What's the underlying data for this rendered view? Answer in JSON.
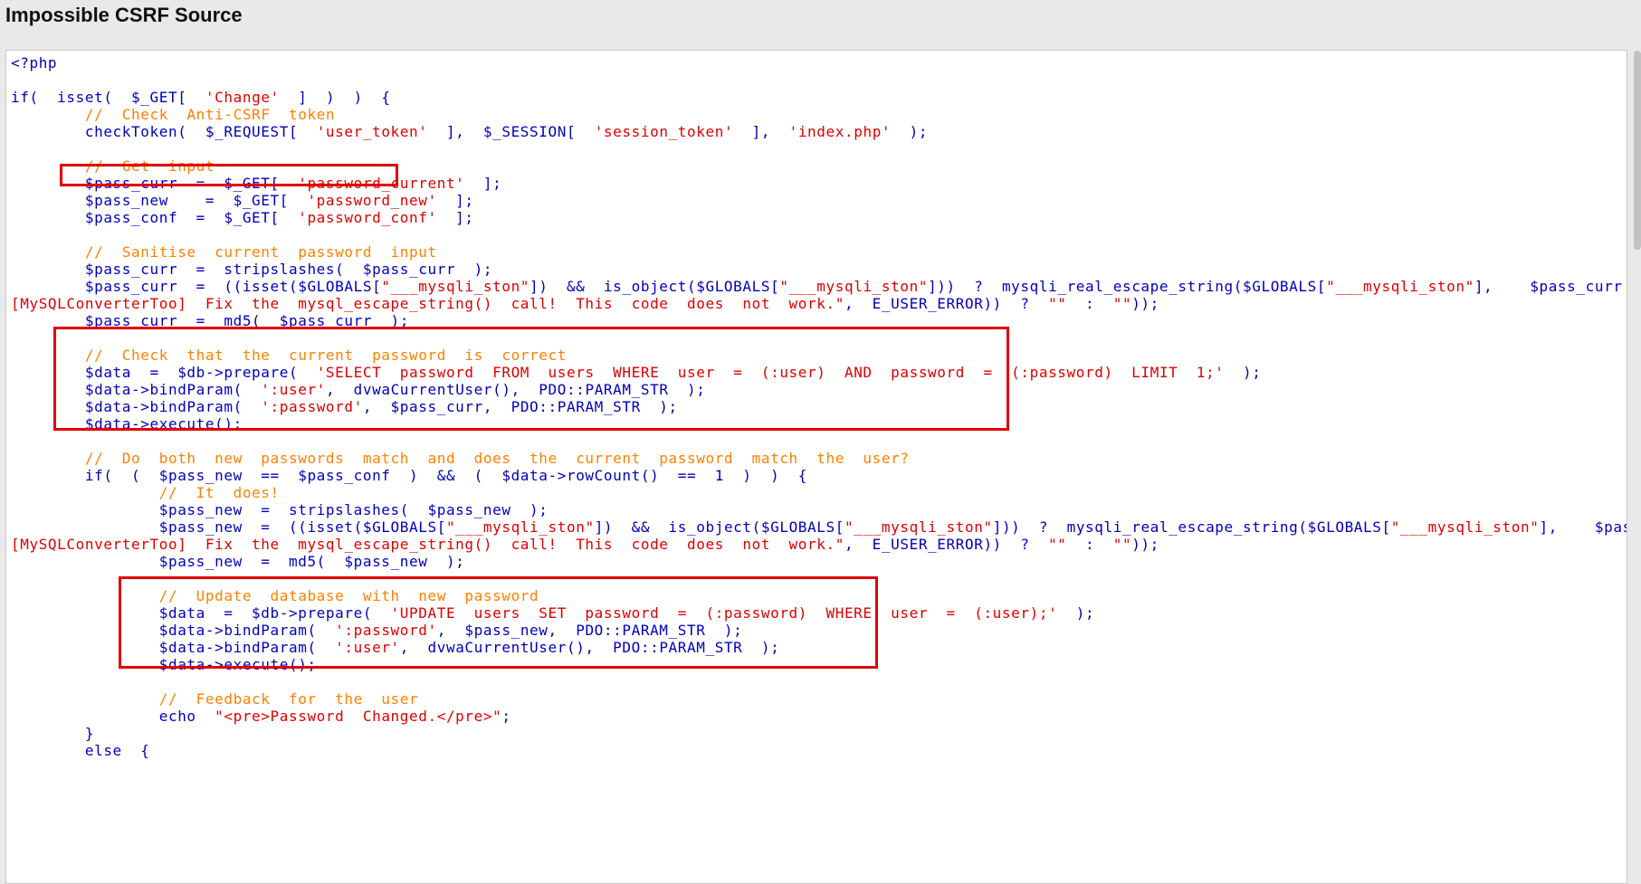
{
  "page": {
    "title": "Impossible CSRF Source"
  },
  "code_lines": [
    {
      "segments": [
        {
          "t": "v",
          "x": "&lt;?php"
        }
      ]
    },
    {
      "segments": []
    },
    {
      "segments": [
        {
          "t": "v",
          "x": "if("
        },
        {
          "t": "p",
          "x": "  "
        },
        {
          "t": "v",
          "x": "isset("
        },
        {
          "t": "p",
          "x": "  "
        },
        {
          "t": "v",
          "x": "$_GET["
        },
        {
          "t": "p",
          "x": "  "
        },
        {
          "t": "s",
          "x": "'Change'"
        },
        {
          "t": "p",
          "x": "  "
        },
        {
          "t": "v",
          "x": "]  )  )  {"
        }
      ]
    },
    {
      "segments": [
        {
          "t": "c",
          "x": "        //  Check  Anti-CSRF  token"
        }
      ]
    },
    {
      "segments": [
        {
          "t": "v",
          "x": "        checkToken(  $_REQUEST[  "
        },
        {
          "t": "s",
          "x": "'user_token'"
        },
        {
          "t": "v",
          "x": "  ],  $_SESSION[  "
        },
        {
          "t": "s",
          "x": "'session_token'"
        },
        {
          "t": "v",
          "x": "  ],  "
        },
        {
          "t": "s",
          "x": "'index.php'"
        },
        {
          "t": "v",
          "x": "  );"
        }
      ]
    },
    {
      "segments": []
    },
    {
      "segments": [
        {
          "t": "c",
          "x": "        //  Get  input"
        }
      ]
    },
    {
      "segments": [
        {
          "t": "v",
          "x": "        $pass_curr  =  $_GET[  "
        },
        {
          "t": "s",
          "x": "'password_current'"
        },
        {
          "t": "v",
          "x": "  ];"
        }
      ]
    },
    {
      "segments": [
        {
          "t": "v",
          "x": "        $pass_new    =  $_GET[  "
        },
        {
          "t": "s",
          "x": "'password_new'"
        },
        {
          "t": "v",
          "x": "  ];"
        }
      ]
    },
    {
      "segments": [
        {
          "t": "v",
          "x": "        $pass_conf  =  $_GET[  "
        },
        {
          "t": "s",
          "x": "'password_conf'"
        },
        {
          "t": "v",
          "x": "  ];"
        }
      ]
    },
    {
      "segments": []
    },
    {
      "segments": [
        {
          "t": "c",
          "x": "        //  Sanitise  current  password  input"
        }
      ]
    },
    {
      "segments": [
        {
          "t": "v",
          "x": "        $pass_curr  =  stripslashes(  $pass_curr  );"
        }
      ]
    },
    {
      "segments": [
        {
          "t": "v",
          "x": "        $pass_curr  =  ((isset($GLOBALS["
        },
        {
          "t": "s",
          "x": "\"___mysqli_ston\""
        },
        {
          "t": "v",
          "x": "])  &&  is_object($GLOBALS["
        },
        {
          "t": "s",
          "x": "\"___mysqli_ston\""
        },
        {
          "t": "v",
          "x": "]))  ?  mysqli_real_escape_string($GLOBALS["
        },
        {
          "t": "s",
          "x": "\"___mysqli_ston\""
        },
        {
          "t": "v",
          "x": "],    $pass_curr  )  :  ((trigger_error("
        }
      ]
    },
    {
      "segments": [
        {
          "t": "s",
          "x": "[MySQLConverterToo]  Fix  the  mysql_escape_string()  call!  This  code  does  not  work.\""
        },
        {
          "t": "v",
          "x": ",  E_USER_ERROR))  ?  "
        },
        {
          "t": "s",
          "x": "\"\""
        },
        {
          "t": "v",
          "x": "  :  "
        },
        {
          "t": "s",
          "x": "\"\""
        },
        {
          "t": "v",
          "x": "));"
        }
      ]
    },
    {
      "segments": [
        {
          "t": "v",
          "x": "        $pass_curr  =  md5(  $pass_curr  );"
        }
      ]
    },
    {
      "segments": []
    },
    {
      "segments": [
        {
          "t": "c",
          "x": "        //  Check  that  the  current  password  is  correct"
        }
      ]
    },
    {
      "segments": [
        {
          "t": "v",
          "x": "        $data  =  $db->prepare(  "
        },
        {
          "t": "s",
          "x": "'SELECT  password  FROM  users  WHERE  user  =  (:user)  AND  password  =  (:password)  LIMIT  1;'"
        },
        {
          "t": "v",
          "x": "  );"
        }
      ]
    },
    {
      "segments": [
        {
          "t": "v",
          "x": "        $data->bindParam(  "
        },
        {
          "t": "s",
          "x": "':user'"
        },
        {
          "t": "v",
          "x": ",  dvwaCurrentUser(),  PDO::PARAM_STR  );"
        }
      ]
    },
    {
      "segments": [
        {
          "t": "v",
          "x": "        $data->bindParam(  "
        },
        {
          "t": "s",
          "x": "':password'"
        },
        {
          "t": "v",
          "x": ",  $pass_curr,  PDO::PARAM_STR  );"
        }
      ]
    },
    {
      "segments": [
        {
          "t": "v",
          "x": "        $data->execute();"
        }
      ]
    },
    {
      "segments": []
    },
    {
      "segments": [
        {
          "t": "c",
          "x": "        //  Do  both  new  passwords  match  and  does  the  current  password  match  the  user?"
        }
      ]
    },
    {
      "segments": [
        {
          "t": "v",
          "x": "        if(  (  $pass_new  ==  $pass_conf  )  &&  (  $data->rowCount()  ==  1  )  )  {"
        }
      ]
    },
    {
      "segments": [
        {
          "t": "c",
          "x": "                //  It  does!"
        }
      ]
    },
    {
      "segments": [
        {
          "t": "v",
          "x": "                $pass_new  =  stripslashes(  $pass_new  );"
        }
      ]
    },
    {
      "segments": [
        {
          "t": "v",
          "x": "                $pass_new  =  ((isset($GLOBALS["
        },
        {
          "t": "s",
          "x": "\"___mysqli_ston\""
        },
        {
          "t": "v",
          "x": "])  &&  is_object($GLOBALS["
        },
        {
          "t": "s",
          "x": "\"___mysqli_ston\""
        },
        {
          "t": "v",
          "x": "]))  ?  mysqli_real_escape_string($GLOBALS["
        },
        {
          "t": "s",
          "x": "\"___mysqli_ston\""
        },
        {
          "t": "v",
          "x": "],    $pass_new  )  :  ((trigger_error("
        }
      ]
    },
    {
      "segments": [
        {
          "t": "s",
          "x": "[MySQLConverterToo]  Fix  the  mysql_escape_string()  call!  This  code  does  not  work.\""
        },
        {
          "t": "v",
          "x": ",  E_USER_ERROR))  ?  "
        },
        {
          "t": "s",
          "x": "\"\""
        },
        {
          "t": "v",
          "x": "  :  "
        },
        {
          "t": "s",
          "x": "\"\""
        },
        {
          "t": "v",
          "x": "));"
        }
      ]
    },
    {
      "segments": [
        {
          "t": "v",
          "x": "                $pass_new  =  md5(  $pass_new  );"
        }
      ]
    },
    {
      "segments": []
    },
    {
      "segments": [
        {
          "t": "c",
          "x": "                //  Update  database  with  new  password"
        }
      ]
    },
    {
      "segments": [
        {
          "t": "v",
          "x": "                $data  =  $db->prepare(  "
        },
        {
          "t": "s",
          "x": "'UPDATE  users  SET  password  =  (:password)  WHERE  user  =  (:user);'"
        },
        {
          "t": "v",
          "x": "  );"
        }
      ]
    },
    {
      "segments": [
        {
          "t": "v",
          "x": "                $data->bindParam(  "
        },
        {
          "t": "s",
          "x": "':password'"
        },
        {
          "t": "v",
          "x": ",  $pass_new,  PDO::PARAM_STR  );"
        }
      ]
    },
    {
      "segments": [
        {
          "t": "v",
          "x": "                $data->bindParam(  "
        },
        {
          "t": "s",
          "x": "':user'"
        },
        {
          "t": "v",
          "x": ",  dvwaCurrentUser(),  PDO::PARAM_STR  );"
        }
      ]
    },
    {
      "segments": [
        {
          "t": "v",
          "x": "                $data->execute();"
        }
      ]
    },
    {
      "segments": []
    },
    {
      "segments": [
        {
          "t": "c",
          "x": "                //  Feedback  for  the  user"
        }
      ]
    },
    {
      "segments": [
        {
          "t": "v",
          "x": "                echo  "
        },
        {
          "t": "s",
          "x": "\"&lt;pre&gt;Password  Changed.&lt;/pre&gt;\""
        },
        {
          "t": "v",
          "x": ";"
        }
      ]
    },
    {
      "segments": [
        {
          "t": "v",
          "x": "        }"
        }
      ]
    },
    {
      "segments": [
        {
          "t": "v",
          "x": "        else  {"
        }
      ]
    }
  ],
  "highlights": [
    {
      "name": "highlight-get-input"
    },
    {
      "name": "highlight-check-password"
    },
    {
      "name": "highlight-update-password"
    }
  ],
  "colors": {
    "comment": "#ff8000",
    "string": "#dd0000",
    "code": "#0000bb",
    "highlight_border": "#e00000"
  }
}
